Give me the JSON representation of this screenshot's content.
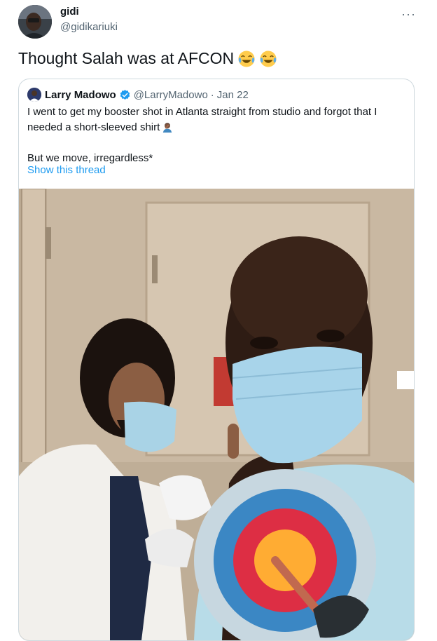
{
  "tweet": {
    "author_name": "gidi",
    "author_handle": "@gidikariuki",
    "more_label": "···",
    "text": "Thought Salah was at AFCON",
    "emoji": [
      "face-with-tears-of-joy",
      "face-with-tears-of-joy"
    ]
  },
  "quoted_tweet": {
    "author_name": "Larry Madowo",
    "verified": true,
    "author_handle": "@LarryMadowo",
    "separator": "·",
    "date": "Jan 22",
    "text_line1": "I went to get my booster shot in Atlanta straight from studio and forgot that I needed a short-sleeved shirt",
    "text_line2": "But we move, irregardless*",
    "emoji": "man-facepalming",
    "show_thread": "Show this thread",
    "media": "photo",
    "overlay_emoji": "direct-hit-target"
  },
  "colors": {
    "text": "#0f1419",
    "secondary": "#536471",
    "link": "#1d9bf0",
    "border": "#cfd9de",
    "verified": "#1d9bf0"
  }
}
